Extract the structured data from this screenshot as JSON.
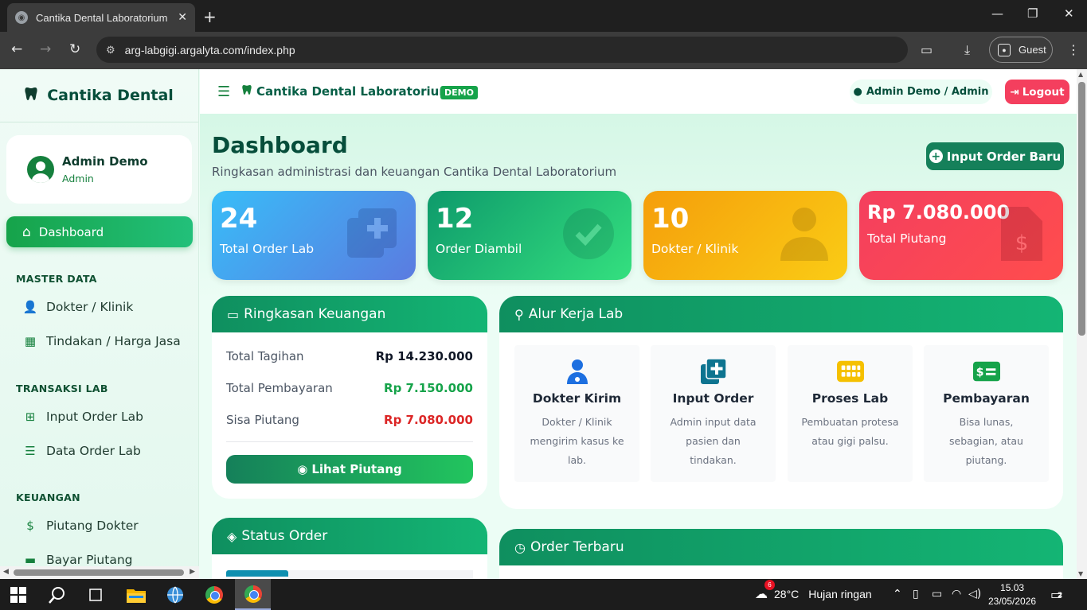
{
  "browser": {
    "tab_title": "Cantika Dental Laboratorium",
    "url": "arg-labgigi.argalyta.com/index.php",
    "profile_label": "Guest"
  },
  "sidebar": {
    "brand": "Cantika Dental",
    "user_name": "Admin Demo",
    "user_role": "Admin",
    "active_item": "Dashboard",
    "sections": [
      {
        "title": "MASTER DATA",
        "items": [
          "Dokter / Klinik",
          "Tindakan / Harga Jasa"
        ]
      },
      {
        "title": "TRANSAKSI LAB",
        "items": [
          "Input Order Lab",
          "Data Order Lab"
        ]
      },
      {
        "title": "KEUANGAN",
        "items": [
          "Piutang Dokter",
          "Bayar Piutang"
        ]
      }
    ]
  },
  "topbar": {
    "brand": "Cantika Dental Laboratorium",
    "badge": "DEMO",
    "user": "Admin Demo / Admin",
    "logout": "Logout"
  },
  "page": {
    "title": "Dashboard",
    "subtitle": "Ringkasan administrasi dan keuangan Cantika Dental Laboratorium",
    "new_order_button": "Input Order Baru"
  },
  "stats": [
    {
      "value": "24",
      "label": "Total Order Lab",
      "color": "#3fb8e0"
    },
    {
      "value": "12",
      "label": "Order Diambil",
      "color": "#10b981"
    },
    {
      "value": "10",
      "label": "Dokter / Klinik",
      "color": "#f59e0b"
    },
    {
      "value": "Rp 7.080.000",
      "label": "Total Piutang",
      "color": "#f43f5e"
    }
  ],
  "keuangan": {
    "title": "Ringkasan Keuangan",
    "rows": [
      {
        "label": "Total Tagihan",
        "value": "Rp 14.230.000",
        "color": "#111827"
      },
      {
        "label": "Total Pembayaran",
        "value": "Rp 7.150.000",
        "color": "#16a34a"
      },
      {
        "label": "Sisa Piutang",
        "value": "Rp 7.080.000",
        "color": "#dc2626"
      }
    ],
    "button": "Lihat Piutang"
  },
  "alur": {
    "title": "Alur Kerja Lab",
    "steps": [
      {
        "title": "Dokter Kirim",
        "desc": "Dokter / Klinik mengirim kasus ke lab.",
        "icon": "doctor-icon"
      },
      {
        "title": "Input Order",
        "desc": "Admin input data pasien dan tindakan.",
        "icon": "add-copy-icon"
      },
      {
        "title": "Proses Lab",
        "desc": "Pembuatan protesa atau gigi palsu.",
        "icon": "grid-icon"
      },
      {
        "title": "Pembayaran",
        "desc": "Bisa lunas, sebagian, atau piutang.",
        "icon": "money-icon"
      }
    ]
  },
  "status_order": {
    "title": "Status Order"
  },
  "order_terbaru": {
    "title": "Order Terbaru"
  },
  "taskbar": {
    "weather_temp": "28°C",
    "weather_desc": "Hujan ringan",
    "weather_badge": "6",
    "time": "15.03",
    "date": "23/05/2026",
    "notif_count": "2"
  }
}
